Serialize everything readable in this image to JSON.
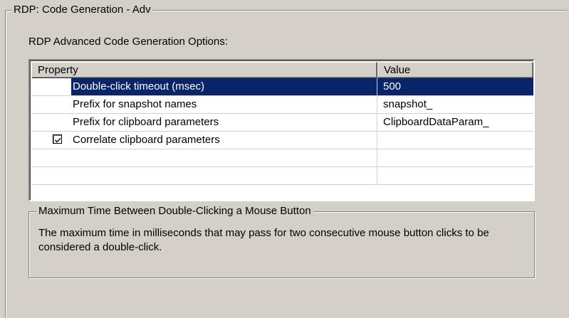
{
  "panel": {
    "title": "RDP: Code Generation - Adv",
    "options_label": "RDP Advanced Code Generation Options:"
  },
  "grid": {
    "columns": [
      "Property",
      "Value"
    ],
    "rows": [
      {
        "property": "Double-click timeout (msec)",
        "value": "500",
        "selected": true
      },
      {
        "property": "Prefix for snapshot names",
        "value": "snapshot_"
      },
      {
        "property": "Prefix for clipboard parameters",
        "value": "ClipboardDataParam_"
      },
      {
        "property": "Correlate clipboard parameters",
        "value": "",
        "checkbox": true,
        "checked": true
      },
      {
        "property": "",
        "value": ""
      },
      {
        "property": "",
        "value": ""
      }
    ]
  },
  "description": {
    "title": "Maximum Time Between Double-Clicking a Mouse Button",
    "text": "The maximum time in milliseconds that may pass for two consecutive mouse button clicks to be considered a double-click."
  },
  "colors": {
    "background": "#d4d0c8",
    "selection": "#0a246a"
  }
}
